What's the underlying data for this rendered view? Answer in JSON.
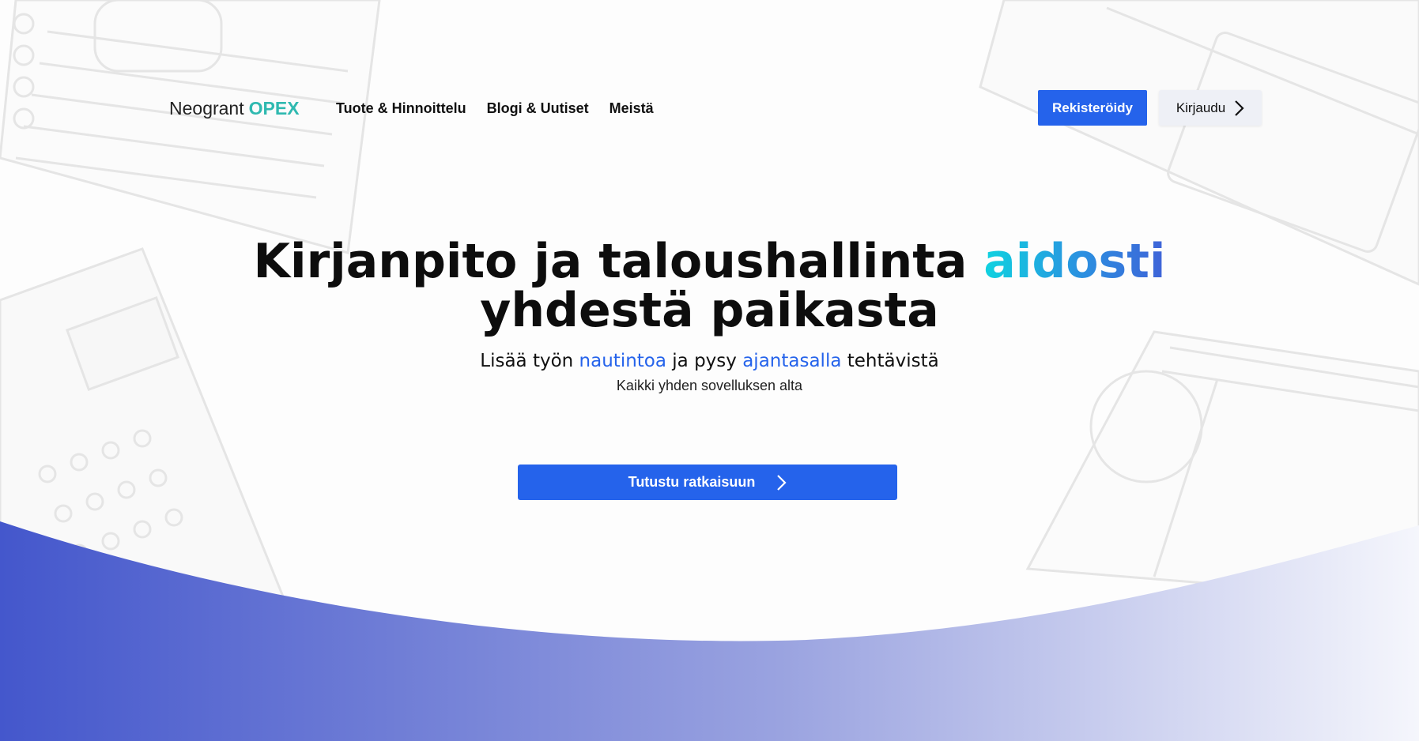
{
  "header": {
    "logo_name": "Neogrant",
    "logo_accent": "OPEX",
    "nav": [
      "Tuote & Hinnoittelu",
      "Blogi & Uutiset",
      "Meistä"
    ],
    "register_label": "Rekisteröidy",
    "login_label": "Kirjaudu"
  },
  "hero": {
    "title_part1": "Kirjanpito ja taloushallinta",
    "title_highlight": "aidosti",
    "title_part2": "yhdestä paikasta",
    "sub_a": "Lisää työn",
    "sub_hl1": "nautintoa",
    "sub_b": "ja pysy",
    "sub_hl2": "ajantasalla",
    "sub_c": "tehtävistä",
    "sub2": "Kaikki yhden sovelluksen alta",
    "cta_label": "Tutustu ratkaisuun"
  },
  "icons": {
    "login": "chevron-right-icon",
    "cta": "chevron-right-icon"
  },
  "colors": {
    "primary": "#2563eb",
    "logo_accent": "#2fb9b0",
    "wave_start": "#4457cc",
    "wave_end": "#f5f6fc"
  }
}
